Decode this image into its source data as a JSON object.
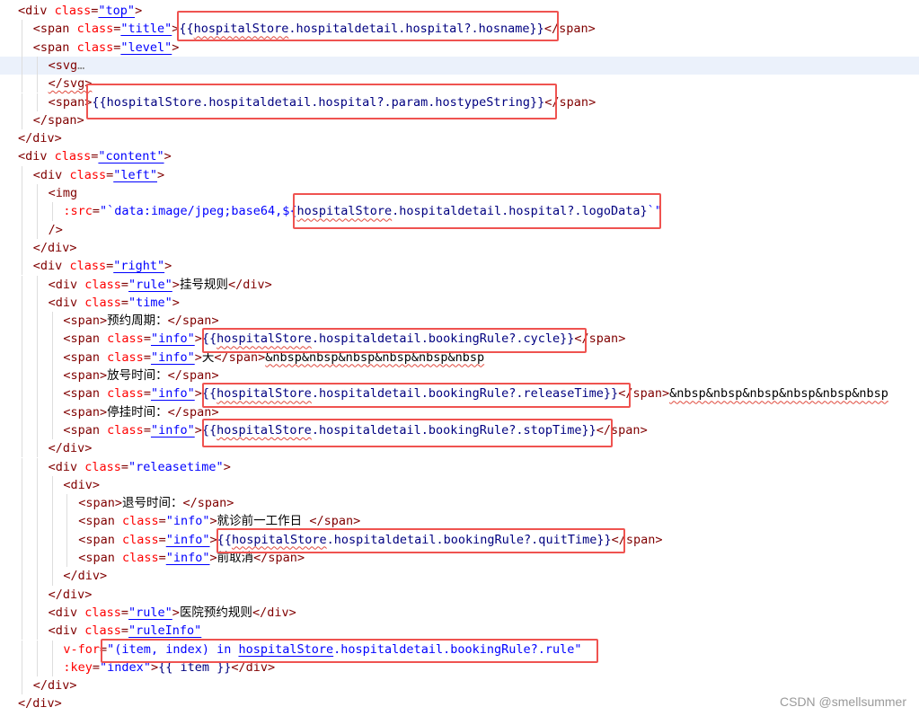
{
  "editor": {
    "language": "vue-template",
    "colors": {
      "tag": "#800000",
      "attribute": "#ff0000",
      "value": "#0000ff",
      "highlight_line": "#ebf1fb",
      "box": "#ef5350"
    },
    "highlighted_line": 4,
    "lines": [
      {
        "indent": 0,
        "tokens": [
          [
            "t",
            "<div "
          ],
          [
            "a",
            "class"
          ],
          [
            "x",
            "="
          ],
          [
            "v",
            "\"top\"",
            "u"
          ],
          [
            "x",
            ">"
          ]
        ]
      },
      {
        "indent": 1,
        "tokens": [
          [
            "t",
            "<span "
          ],
          [
            "a",
            "class"
          ],
          [
            "x",
            "="
          ],
          [
            "v",
            "\"title\"",
            "u"
          ],
          [
            "x",
            ">"
          ],
          [
            "e",
            "{{"
          ],
          [
            "e",
            "hospitalStore",
            "sq"
          ],
          [
            "e",
            ".hospitaldetail.hospital?.hosname}}"
          ],
          [
            "x",
            "</span>"
          ]
        ]
      },
      {
        "indent": 1,
        "tokens": [
          [
            "t",
            "<span "
          ],
          [
            "a",
            "class"
          ],
          [
            "x",
            "="
          ],
          [
            "v",
            "\"level\"",
            "u"
          ],
          [
            "x",
            ">"
          ]
        ]
      },
      {
        "indent": 2,
        "tokens": [
          [
            "t",
            "<svg"
          ],
          [
            "d",
            "…"
          ]
        ]
      },
      {
        "indent": 2,
        "tokens": [
          [
            "t",
            "</svg>",
            "sq"
          ]
        ]
      },
      {
        "indent": 2,
        "tokens": [
          [
            "t",
            "<span>"
          ],
          [
            "e",
            "{{hospitalStore.hospitaldetail.hospital?.param.hostypeString}}"
          ],
          [
            "x",
            "</span>"
          ]
        ]
      },
      {
        "indent": 1,
        "tokens": [
          [
            "t",
            "</span>"
          ]
        ]
      },
      {
        "indent": 0,
        "tokens": [
          [
            "t",
            "</div>"
          ]
        ]
      },
      {
        "indent": 0,
        "tokens": [
          [
            "t",
            "<div "
          ],
          [
            "a",
            "class"
          ],
          [
            "x",
            "="
          ],
          [
            "v",
            "\"content\"",
            "u"
          ],
          [
            "x",
            ">"
          ]
        ]
      },
      {
        "indent": 1,
        "tokens": [
          [
            "t",
            "<div "
          ],
          [
            "a",
            "class"
          ],
          [
            "x",
            "="
          ],
          [
            "v",
            "\"left\"",
            "u"
          ],
          [
            "x",
            ">"
          ]
        ]
      },
      {
        "indent": 2,
        "tokens": [
          [
            "t",
            "<img"
          ]
        ]
      },
      {
        "indent": 3,
        "tokens": [
          [
            "a",
            ":src"
          ],
          [
            "x",
            "="
          ],
          [
            "v",
            "\"`data:image/jpeg;base64,${"
          ],
          [
            "e",
            "hospitalStore",
            "sq"
          ],
          [
            "e",
            ".hospitaldetail.hospital?.logoData}"
          ],
          [
            "v",
            "`\""
          ]
        ]
      },
      {
        "indent": 2,
        "tokens": [
          [
            "t",
            "/>"
          ]
        ]
      },
      {
        "indent": 1,
        "tokens": [
          [
            "t",
            "</div>"
          ]
        ]
      },
      {
        "indent": 1,
        "tokens": [
          [
            "t",
            "<div "
          ],
          [
            "a",
            "class"
          ],
          [
            "x",
            "="
          ],
          [
            "v",
            "\"right\"",
            "u"
          ],
          [
            "x",
            ">"
          ]
        ]
      },
      {
        "indent": 2,
        "tokens": [
          [
            "t",
            "<div "
          ],
          [
            "a",
            "class"
          ],
          [
            "x",
            "="
          ],
          [
            "v",
            "\"rule\"",
            "u"
          ],
          [
            "x",
            ">"
          ],
          [
            "c",
            "挂号规则"
          ],
          [
            "x",
            "</div>"
          ]
        ]
      },
      {
        "indent": 2,
        "tokens": [
          [
            "t",
            "<div "
          ],
          [
            "a",
            "class"
          ],
          [
            "x",
            "="
          ],
          [
            "v",
            "\"time\""
          ],
          [
            "x",
            ">"
          ]
        ]
      },
      {
        "indent": 3,
        "tokens": [
          [
            "t",
            "<span>"
          ],
          [
            "c",
            "预约周期："
          ],
          [
            "x",
            "</span>"
          ]
        ]
      },
      {
        "indent": 3,
        "tokens": [
          [
            "t",
            "<span "
          ],
          [
            "a",
            "class"
          ],
          [
            "x",
            "="
          ],
          [
            "v",
            "\"info\"",
            "u"
          ],
          [
            "x",
            ">"
          ],
          [
            "e",
            "{{"
          ],
          [
            "e",
            "hospitalStore",
            "sq"
          ],
          [
            "e",
            ".hospitaldetail.bookingRule?.cycle}}"
          ],
          [
            "x",
            "</span>"
          ]
        ]
      },
      {
        "indent": 3,
        "tokens": [
          [
            "t",
            "<span "
          ],
          [
            "a",
            "class"
          ],
          [
            "x",
            "="
          ],
          [
            "v",
            "\"info\"",
            "u"
          ],
          [
            "x",
            ">"
          ],
          [
            "c",
            "天"
          ],
          [
            "x",
            "</span>"
          ],
          [
            "c",
            "&nbsp&nbsp&nbsp&nbsp&nbsp&nbsp",
            "sq"
          ]
        ]
      },
      {
        "indent": 3,
        "tokens": [
          [
            "t",
            "<span>"
          ],
          [
            "c",
            "放号时间："
          ],
          [
            "x",
            "</span>"
          ]
        ]
      },
      {
        "indent": 3,
        "tokens": [
          [
            "t",
            "<span "
          ],
          [
            "a",
            "class"
          ],
          [
            "x",
            "="
          ],
          [
            "v",
            "\"info\"",
            "u"
          ],
          [
            "x",
            ">"
          ],
          [
            "e",
            "{{"
          ],
          [
            "e",
            "hospitalStore",
            "sq"
          ],
          [
            "e",
            ".hospitaldetail.bookingRule?.releaseTime}}"
          ],
          [
            "x",
            "</span>"
          ],
          [
            "c",
            "&nbsp&nbsp&nbsp&nbsp&nbsp&nbsp",
            "sq"
          ]
        ]
      },
      {
        "indent": 3,
        "tokens": [
          [
            "t",
            "<span>"
          ],
          [
            "c",
            "停挂时间："
          ],
          [
            "x",
            "</span>"
          ]
        ]
      },
      {
        "indent": 3,
        "tokens": [
          [
            "t",
            "<span "
          ],
          [
            "a",
            "class"
          ],
          [
            "x",
            "="
          ],
          [
            "v",
            "\"info\"",
            "u"
          ],
          [
            "x",
            ">"
          ],
          [
            "e",
            "{{"
          ],
          [
            "e",
            "hospitalStore",
            "sq"
          ],
          [
            "e",
            ".hospitaldetail.bookingRule?.stopTime}}"
          ],
          [
            "x",
            "</span>"
          ]
        ]
      },
      {
        "indent": 2,
        "tokens": [
          [
            "t",
            "</div>"
          ]
        ]
      },
      {
        "indent": 2,
        "tokens": [
          [
            "t",
            "<div "
          ],
          [
            "a",
            "class"
          ],
          [
            "x",
            "="
          ],
          [
            "v",
            "\"releasetime\""
          ],
          [
            "x",
            ">"
          ]
        ]
      },
      {
        "indent": 3,
        "tokens": [
          [
            "t",
            "<div>"
          ]
        ]
      },
      {
        "indent": 4,
        "tokens": [
          [
            "t",
            "<span>"
          ],
          [
            "c",
            "退号时间："
          ],
          [
            "x",
            "</span>"
          ]
        ]
      },
      {
        "indent": 4,
        "tokens": [
          [
            "t",
            "<span "
          ],
          [
            "a",
            "class"
          ],
          [
            "x",
            "="
          ],
          [
            "v",
            "\"info\""
          ],
          [
            "x",
            ">"
          ],
          [
            "c",
            "就诊前一工作日 "
          ],
          [
            "x",
            "</span>"
          ]
        ]
      },
      {
        "indent": 4,
        "tokens": [
          [
            "t",
            "<span "
          ],
          [
            "a",
            "class"
          ],
          [
            "x",
            "="
          ],
          [
            "v",
            "\"info\"",
            "u"
          ],
          [
            "x",
            ">"
          ],
          [
            "e",
            "{{"
          ],
          [
            "e",
            "hospitalStore",
            "sq"
          ],
          [
            "e",
            ".hospitaldetail.bookingRule?.quitTime}}"
          ],
          [
            "x",
            "</span>"
          ]
        ]
      },
      {
        "indent": 4,
        "tokens": [
          [
            "t",
            "<span "
          ],
          [
            "a",
            "class"
          ],
          [
            "x",
            "="
          ],
          [
            "v",
            "\"info\"",
            "u"
          ],
          [
            "x",
            ">"
          ],
          [
            "c",
            "前取消"
          ],
          [
            "x",
            "</span>"
          ]
        ]
      },
      {
        "indent": 3,
        "tokens": [
          [
            "t",
            "</div>"
          ]
        ]
      },
      {
        "indent": 2,
        "tokens": [
          [
            "t",
            "</div>"
          ]
        ]
      },
      {
        "indent": 2,
        "tokens": [
          [
            "t",
            "<div "
          ],
          [
            "a",
            "class"
          ],
          [
            "x",
            "="
          ],
          [
            "v",
            "\"rule\"",
            "u"
          ],
          [
            "x",
            ">"
          ],
          [
            "c",
            "医院预约规则"
          ],
          [
            "x",
            "</div>"
          ]
        ]
      },
      {
        "indent": 2,
        "tokens": [
          [
            "t",
            "<div "
          ],
          [
            "a",
            "class"
          ],
          [
            "x",
            "="
          ],
          [
            "v",
            "\"ruleInfo\"",
            "u"
          ]
        ]
      },
      {
        "indent": 3,
        "tokens": [
          [
            "a",
            "v-for"
          ],
          [
            "x",
            "="
          ],
          [
            "v",
            "\"(item, index) in "
          ],
          [
            "v",
            "hospitalStore",
            "u"
          ],
          [
            "v",
            ".hospitaldetail.bookingRule?.rule\""
          ]
        ]
      },
      {
        "indent": 3,
        "tokens": [
          [
            "a",
            ":key"
          ],
          [
            "x",
            "="
          ],
          [
            "v",
            "\"index\""
          ],
          [
            "x",
            ">"
          ],
          [
            "e",
            "{{ item }}"
          ],
          [
            "x",
            "</div>"
          ]
        ]
      },
      {
        "indent": 1,
        "tokens": [
          [
            "t",
            "</div>"
          ]
        ]
      },
      {
        "indent": 0,
        "tokens": [
          [
            "t",
            "</div>"
          ]
        ]
      }
    ]
  },
  "watermark": "CSDN @smellsummer"
}
